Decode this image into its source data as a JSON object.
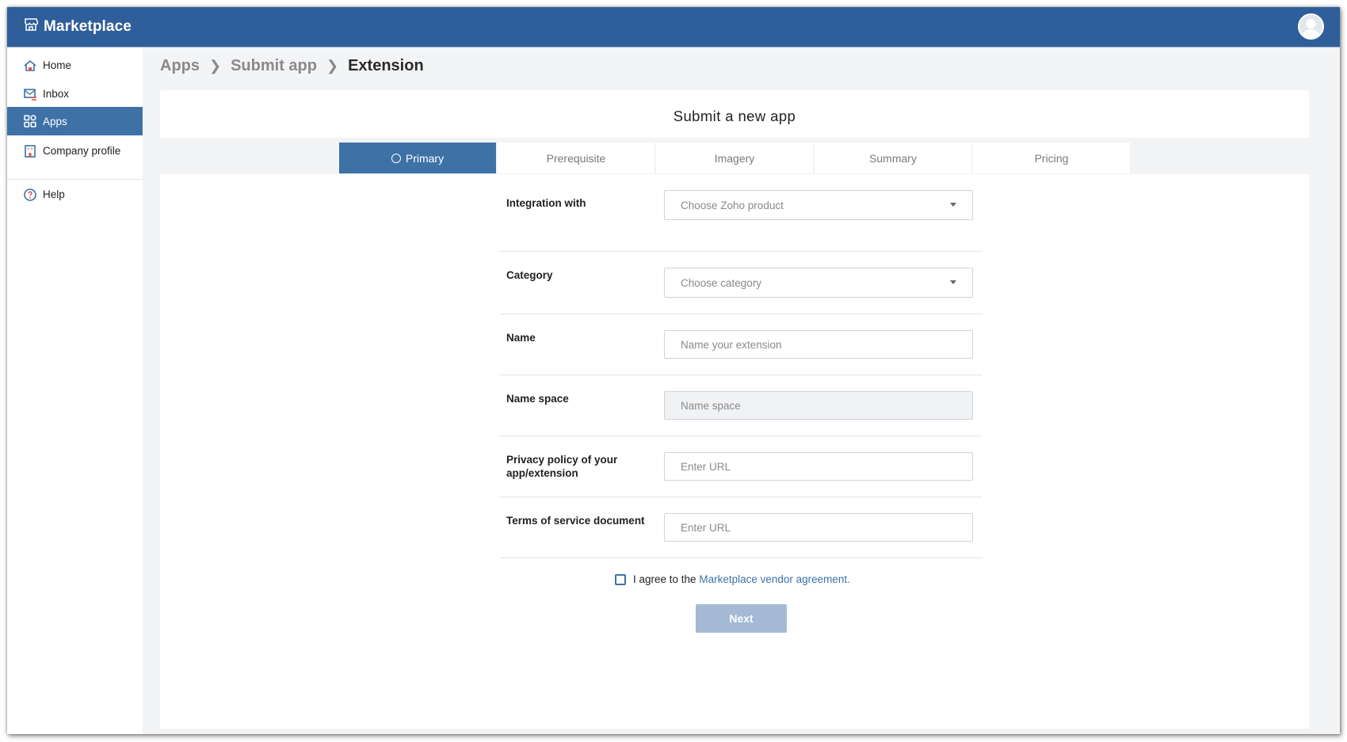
{
  "app": {
    "title": "Marketplace",
    "brand_icon": "storefront-icon",
    "avatar_icon": "user-avatar-icon"
  },
  "colors": {
    "topbar": "#2f5f9a",
    "accent": "#3e72a7",
    "link": "#3e72a7",
    "button_disabled": "#a4bad4",
    "background": "#f3f4f6"
  },
  "sidebar": {
    "items": [
      {
        "label": "Home",
        "icon": "home-icon",
        "active": false
      },
      {
        "label": "Inbox",
        "icon": "inbox-icon",
        "active": false
      },
      {
        "label": "Apps",
        "icon": "apps-grid-icon",
        "active": true
      },
      {
        "label": "Company profile",
        "icon": "building-icon",
        "active": false
      },
      {
        "label": "Help",
        "icon": "help-icon",
        "active": false
      }
    ]
  },
  "breadcrumb": {
    "items": [
      "Apps",
      "Submit app",
      "Extension"
    ],
    "separator": ">"
  },
  "panel": {
    "title": "Submit a new app"
  },
  "tabs": [
    {
      "label": "Primary",
      "active": true
    },
    {
      "label": "Prerequisite",
      "active": false
    },
    {
      "label": "Imagery",
      "active": false
    },
    {
      "label": "Summary",
      "active": false
    },
    {
      "label": "Pricing",
      "active": false
    }
  ],
  "form": {
    "fields": [
      {
        "label": "Integration with",
        "type": "select",
        "placeholder": "Choose Zoho product",
        "value": ""
      },
      {
        "label": "Category",
        "type": "select",
        "placeholder": "Choose category",
        "value": ""
      },
      {
        "label": "Name",
        "type": "text",
        "placeholder": "Name your extension",
        "value": ""
      },
      {
        "label": "Name space",
        "type": "text",
        "placeholder": "Name space",
        "value": "",
        "disabled": true
      },
      {
        "label": "Privacy policy of your app/extension",
        "type": "url",
        "placeholder": "Enter URL",
        "value": ""
      },
      {
        "label": "Terms of service document",
        "type": "url",
        "placeholder": "Enter URL",
        "value": ""
      }
    ],
    "agreement": {
      "prefix": "I agree to the",
      "link_text": "Marketplace vendor agreement.",
      "checked": false
    },
    "next_label": "Next"
  }
}
